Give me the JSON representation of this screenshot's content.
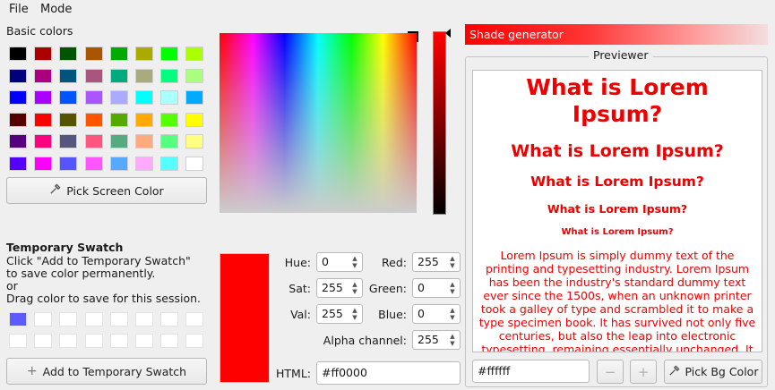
{
  "menu": {
    "file": "File",
    "mode": "Mode"
  },
  "basic_colors": {
    "label": "Basic colors",
    "colors": [
      [
        "#000000",
        "#aa0000",
        "#005500",
        "#aa5500",
        "#00aa00",
        "#aaaa00",
        "#00ff00",
        "#aaff00"
      ],
      [
        "#00007f",
        "#aa007f",
        "#00557f",
        "#aa557f",
        "#00aa7f",
        "#aaaa7f",
        "#00ff7f",
        "#aaff7f"
      ],
      [
        "#0000ff",
        "#aa00ff",
        "#0055ff",
        "#aa55ff",
        "#aaaaff",
        "#00ffff",
        "#aaffff",
        "#00aaff"
      ],
      [
        "#550000",
        "#ff0000",
        "#555500",
        "#ff5500",
        "#55aa00",
        "#ffaa00",
        "#55ff00",
        "#ffff00"
      ],
      [
        "#55007f",
        "#ff007f",
        "#55557f",
        "#ff557f",
        "#55aa7f",
        "#ffaa7f",
        "#55ff7f",
        "#ffff7f"
      ],
      [
        "#5500ff",
        "#ff00ff",
        "#5555ff",
        "#ff55ff",
        "#55aaff",
        "#ffaaff",
        "#55ffff",
        "#ffffff"
      ]
    ]
  },
  "pick_screen_button": {
    "label": "Pick Screen Color",
    "icon": "eyedropper-icon"
  },
  "temporary_swatch": {
    "title": "Temporary Swatch",
    "line1": "Click \"Add to Temporary Swatch\"",
    "line2": "to save color permanently.",
    "line3": "or",
    "line4": "Drag color to save for this session.",
    "slots": [
      [
        "#5b5bff",
        "#ffffff",
        "#ffffff",
        "#ffffff",
        "#ffffff",
        "#ffffff",
        "#ffffff",
        "#ffffff"
      ],
      [
        "#ffffff",
        "#ffffff",
        "#ffffff",
        "#ffffff",
        "#ffffff",
        "#ffffff",
        "#ffffff",
        "#ffffff"
      ]
    ],
    "add_button": "Add to Temporary Swatch"
  },
  "current_color": "#ff0000",
  "fields": {
    "hue": {
      "label": "Hue:",
      "value": "0"
    },
    "sat": {
      "label": "Sat:",
      "value": "255"
    },
    "val": {
      "label": "Val:",
      "value": "255"
    },
    "red": {
      "label": "Red:",
      "value": "255"
    },
    "green": {
      "label": "Green:",
      "value": "0"
    },
    "blue": {
      "label": "Blue:",
      "value": "0"
    },
    "alpha": {
      "label": "Alpha channel:",
      "value": "255"
    },
    "html": {
      "label": "HTML:",
      "value": "#ff0000"
    }
  },
  "shade_generator": {
    "label": "Shade generator"
  },
  "previewer": {
    "title": "Previewer",
    "h1": "What is Lorem Ipsum?",
    "h2": "What is Lorem Ipsum?",
    "h3": "What is Lorem Ipsum?",
    "h4": "What is Lorem Ipsum?",
    "h5": "What is Lorem Ipsum?",
    "paragraph": "Lorem Ipsum is simply dummy text of the printing and typesetting industry. Lorem Ipsum has been the industry's standard dummy text ever since the 1500s, when an unknown printer took a galley of type and scrambled it to make a type specimen book. It has survived not only five centuries, but also the leap into electronic typesetting, remaining essentially unchanged. It",
    "text_color": "#ee0000"
  },
  "bg_color_field": {
    "value": "#ffffff"
  },
  "minus_button": "−",
  "plus_button": "+",
  "pick_bg_button": {
    "label": "Pick Bg Color",
    "icon": "eyedropper-icon"
  }
}
